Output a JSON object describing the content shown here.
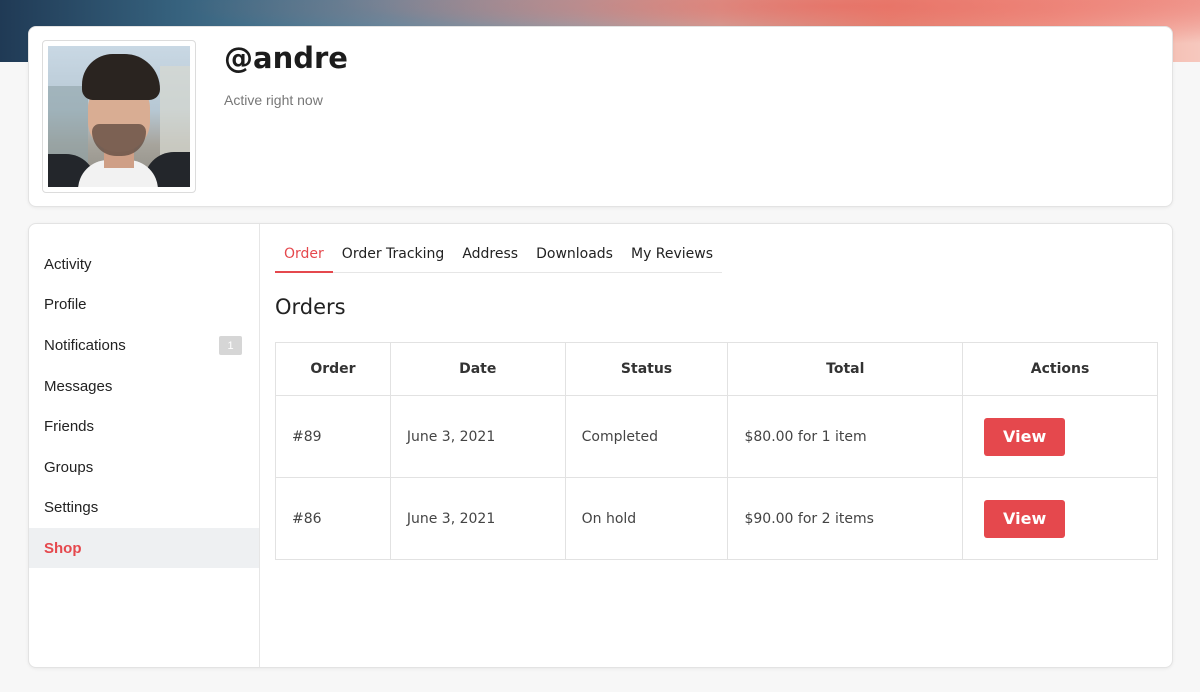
{
  "profile": {
    "username": "@andre",
    "status": "Active right now"
  },
  "sidebar": {
    "items": [
      {
        "label": "Activity"
      },
      {
        "label": "Profile"
      },
      {
        "label": "Notifications",
        "badge": "1"
      },
      {
        "label": "Messages"
      },
      {
        "label": "Friends"
      },
      {
        "label": "Groups"
      },
      {
        "label": "Settings"
      },
      {
        "label": "Shop",
        "active": true
      }
    ]
  },
  "tabs": [
    {
      "label": "Order",
      "active": true
    },
    {
      "label": "Order Tracking"
    },
    {
      "label": "Address"
    },
    {
      "label": "Downloads"
    },
    {
      "label": "My Reviews"
    }
  ],
  "orders": {
    "title": "Orders",
    "columns": [
      "Order",
      "Date",
      "Status",
      "Total",
      "Actions"
    ],
    "rows": [
      {
        "order": "#89",
        "date": "June 3, 2021",
        "status": "Completed",
        "total": "$80.00 for 1 item",
        "action": "View"
      },
      {
        "order": "#86",
        "date": "June 3, 2021",
        "status": "On hold",
        "total": "$90.00 for 2 items",
        "action": "View"
      }
    ]
  },
  "colors": {
    "accent": "#e5484d",
    "badge": "#d6d6d6"
  }
}
